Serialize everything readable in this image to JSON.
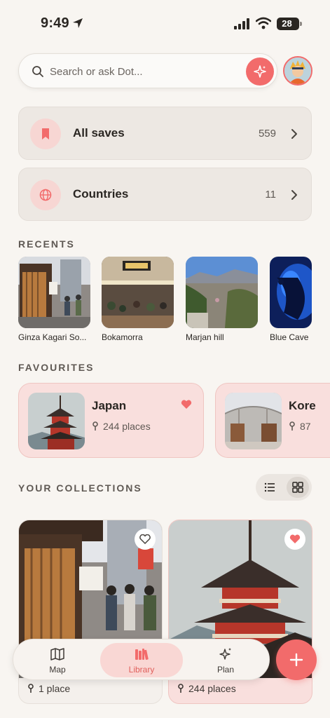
{
  "status_bar": {
    "time": "9:49",
    "battery": "28"
  },
  "search": {
    "placeholder": "Search or ask Dot..."
  },
  "saves": [
    {
      "label": "All saves",
      "count": "559",
      "icon": "bookmark-icon"
    },
    {
      "label": "Countries",
      "count": "11",
      "icon": "globe-icon"
    }
  ],
  "recents": {
    "title": "RECENTS",
    "items": [
      {
        "label": "Ginza Kagari So..."
      },
      {
        "label": "Bokamorra"
      },
      {
        "label": "Marjan hill"
      },
      {
        "label": "Blue Cave"
      }
    ]
  },
  "favourites": {
    "title": "FAVOURITES",
    "items": [
      {
        "title": "Japan",
        "places": "244 places"
      },
      {
        "title": "Kore",
        "places": "87"
      }
    ]
  },
  "collections": {
    "title": "YOUR COLLECTIONS",
    "items": [
      {
        "places": "1 place",
        "liked": false
      },
      {
        "places": "244 places",
        "liked": true
      }
    ]
  },
  "nav": {
    "items": [
      {
        "label": "Map",
        "icon": "map-icon"
      },
      {
        "label": "Library",
        "icon": "library-icon"
      },
      {
        "label": "Plan",
        "icon": "sparkle-icon"
      }
    ],
    "active": "Library"
  },
  "colors": {
    "accent": "#f26b6b",
    "background": "#f8f5f1",
    "card": "#ede8e3",
    "favourite_card": "#f9dfdd"
  }
}
